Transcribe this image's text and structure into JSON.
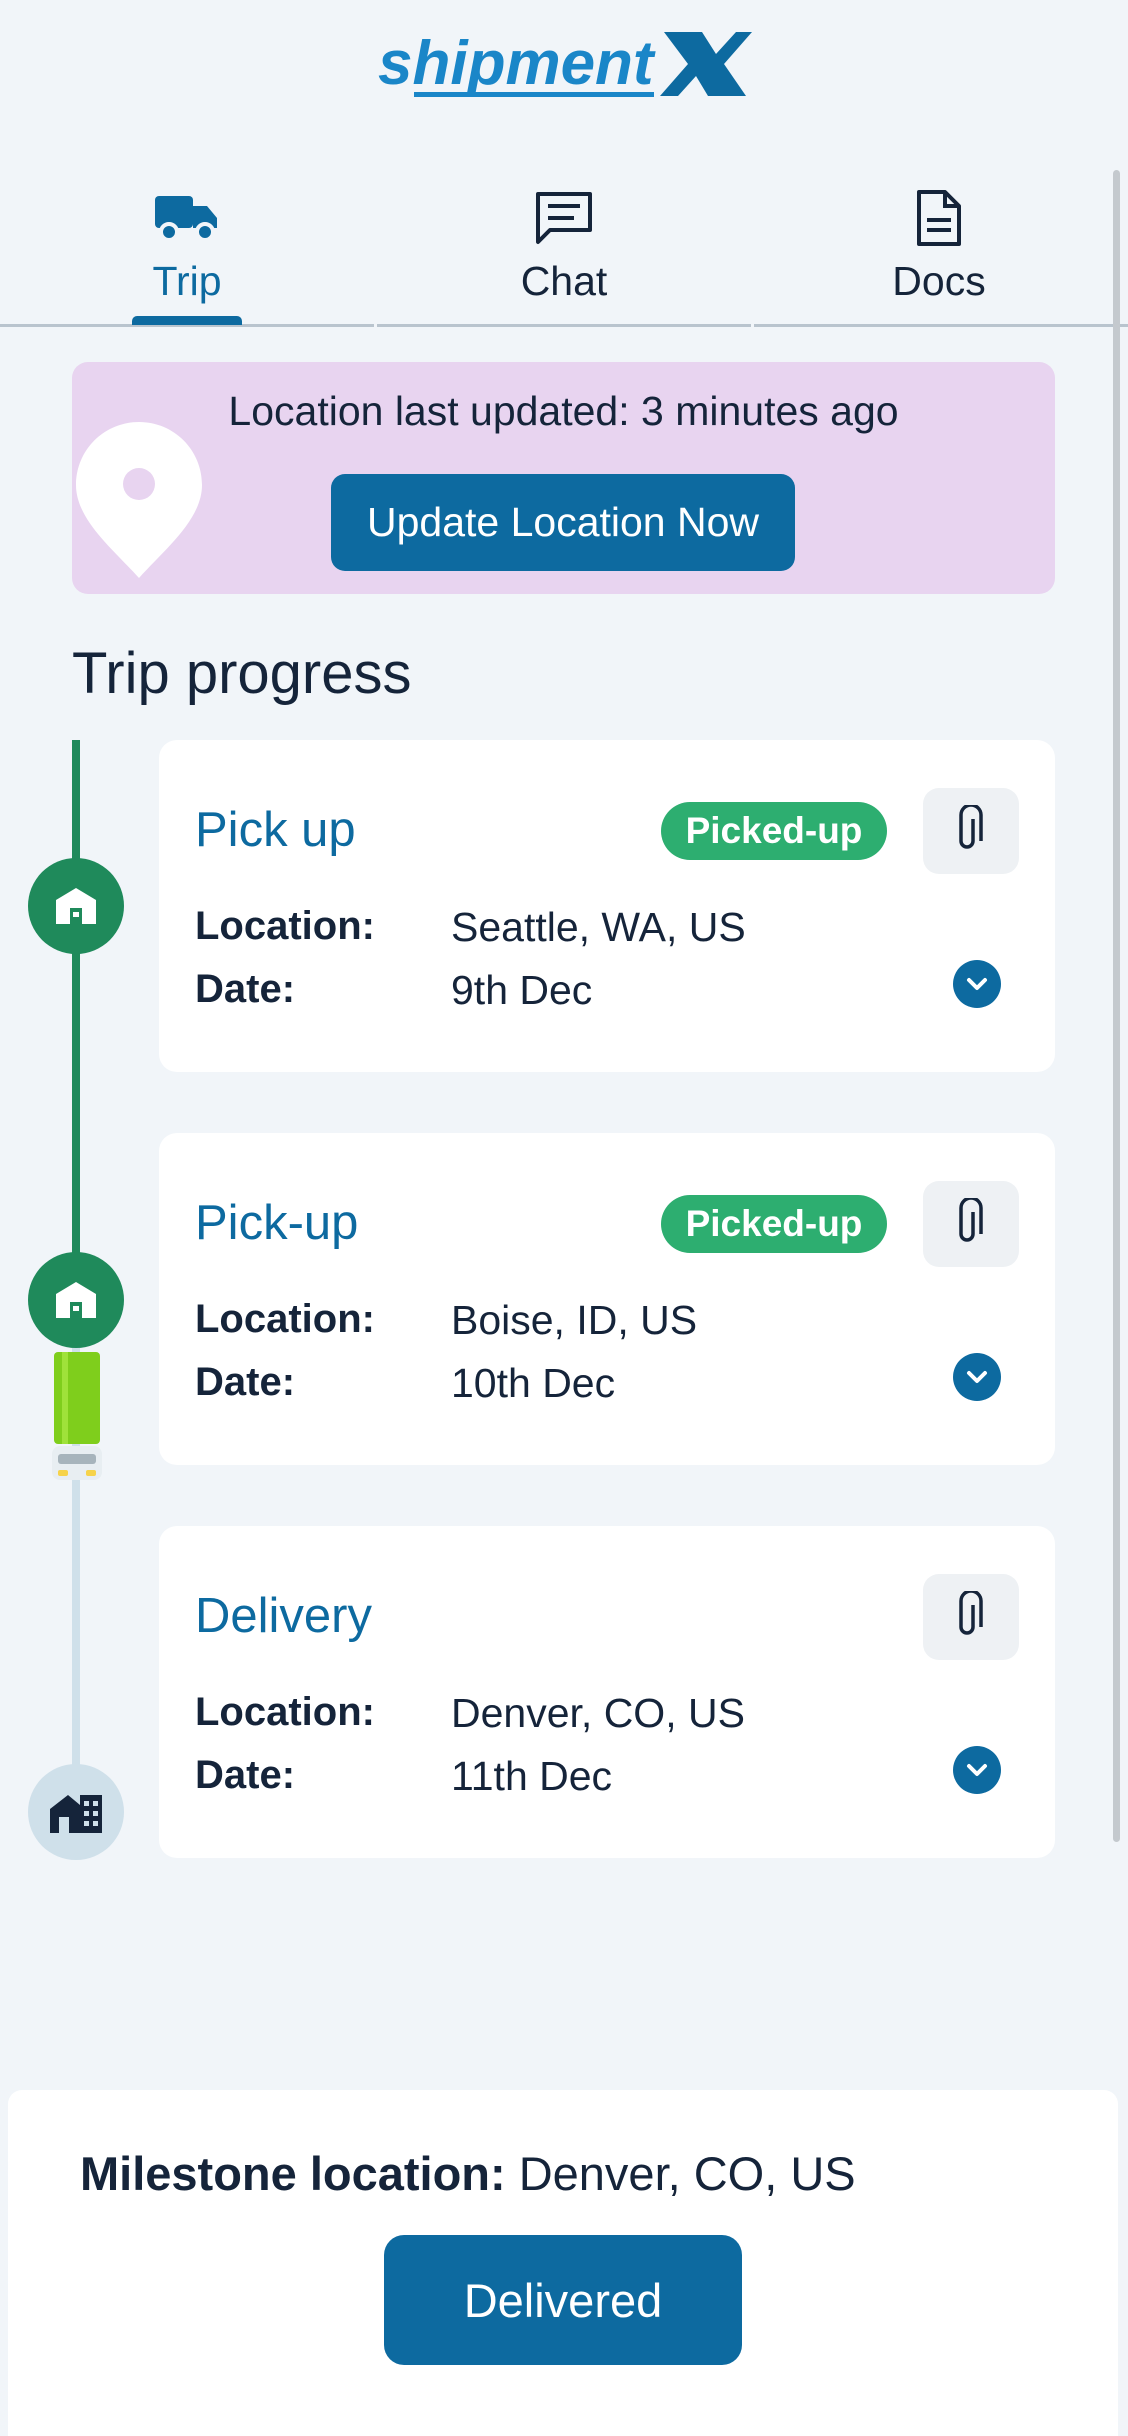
{
  "app": {
    "logo_text_light": "shipment",
    "logo_text_bold": "X",
    "brand_color": "#0d6aa0"
  },
  "tabs": [
    {
      "label": "Trip",
      "icon": "truck-icon",
      "active": true
    },
    {
      "label": "Chat",
      "icon": "chat-icon",
      "active": false
    },
    {
      "label": "Docs",
      "icon": "document-icon",
      "active": false
    }
  ],
  "banner": {
    "text": "Location last updated: 3 minutes ago",
    "button_label": "Update Location Now",
    "icon": "location-pin-icon",
    "background": "#e8d4f0"
  },
  "section_title": "Trip progress",
  "stops": [
    {
      "title": "Pick up",
      "status": "Picked-up",
      "location_label": "Location:",
      "location": "Seattle, WA, US",
      "date_label": "Date:",
      "date": "9th Dec",
      "icon": "warehouse-icon"
    },
    {
      "title": "Pick-up",
      "status": "Picked-up",
      "location_label": "Location:",
      "location": "Boise, ID, US",
      "date_label": "Date:",
      "date": "10th Dec",
      "icon": "warehouse-icon"
    },
    {
      "title": "Delivery",
      "status": "",
      "location_label": "Location:",
      "location": "Denver, CO, US",
      "date_label": "Date:",
      "date": "11th Dec",
      "icon": "home-building-icon"
    }
  ],
  "status_colors": {
    "done": "#1f8a5b",
    "badge": "#2dae70",
    "pending": "#cfe0ea"
  },
  "bottom": {
    "milestone_label": "Milestone location:",
    "milestone_value": "Denver, CO, US",
    "button_label": "Delivered"
  }
}
